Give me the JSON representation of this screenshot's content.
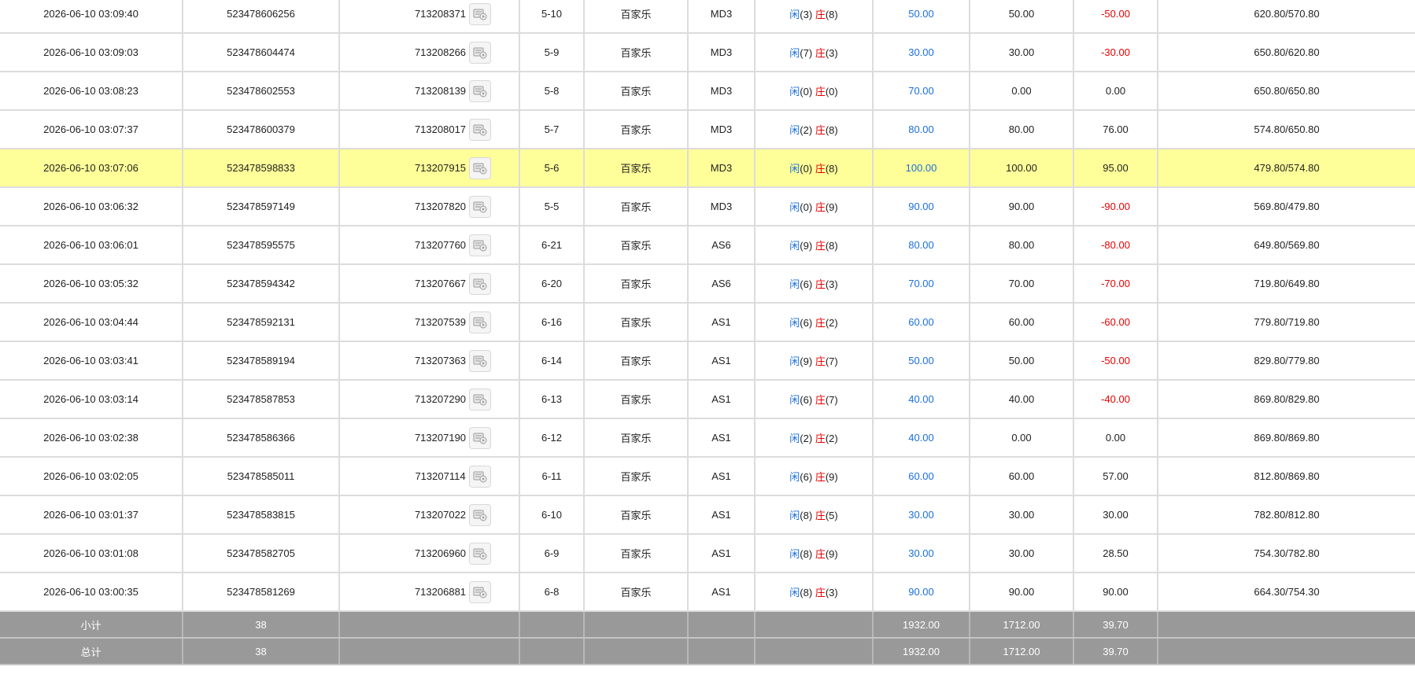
{
  "colors": {
    "highlight_row": "#ffff99",
    "summary_bg": "#999999",
    "blue": "#1a6fd9",
    "red": "#e60000"
  },
  "icon": "video-replay-icon",
  "rows": [
    {
      "time": "2026-06-10 03:09:40",
      "order_no": "523478606256",
      "game_no": "713208371",
      "shoe": "5-10",
      "game": "百家乐",
      "table": "MD3",
      "xian_label": "闲",
      "xian_val": "(3)",
      "zhuang_label": "庄",
      "zhuang_val": "(8)",
      "bet": "50.00",
      "valid": "50.00",
      "win": "-50.00",
      "balance": "620.80/570.80",
      "highlight": false
    },
    {
      "time": "2026-06-10 03:09:03",
      "order_no": "523478604474",
      "game_no": "713208266",
      "shoe": "5-9",
      "game": "百家乐",
      "table": "MD3",
      "xian_label": "闲",
      "xian_val": "(7)",
      "zhuang_label": "庄",
      "zhuang_val": "(3)",
      "bet": "30.00",
      "valid": "30.00",
      "win": "-30.00",
      "balance": "650.80/620.80",
      "highlight": false
    },
    {
      "time": "2026-06-10 03:08:23",
      "order_no": "523478602553",
      "game_no": "713208139",
      "shoe": "5-8",
      "game": "百家乐",
      "table": "MD3",
      "xian_label": "闲",
      "xian_val": "(0)",
      "zhuang_label": "庄",
      "zhuang_val": "(0)",
      "bet": "70.00",
      "valid": "0.00",
      "win": "0.00",
      "balance": "650.80/650.80",
      "highlight": false
    },
    {
      "time": "2026-06-10 03:07:37",
      "order_no": "523478600379",
      "game_no": "713208017",
      "shoe": "5-7",
      "game": "百家乐",
      "table": "MD3",
      "xian_label": "闲",
      "xian_val": "(2)",
      "zhuang_label": "庄",
      "zhuang_val": "(8)",
      "bet": "80.00",
      "valid": "80.00",
      "win": "76.00",
      "balance": "574.80/650.80",
      "highlight": false
    },
    {
      "time": "2026-06-10 03:07:06",
      "order_no": "523478598833",
      "game_no": "713207915",
      "shoe": "5-6",
      "game": "百家乐",
      "table": "MD3",
      "xian_label": "闲",
      "xian_val": "(0)",
      "zhuang_label": "庄",
      "zhuang_val": "(8)",
      "bet": "100.00",
      "valid": "100.00",
      "win": "95.00",
      "balance": "479.80/574.80",
      "highlight": true
    },
    {
      "time": "2026-06-10 03:06:32",
      "order_no": "523478597149",
      "game_no": "713207820",
      "shoe": "5-5",
      "game": "百家乐",
      "table": "MD3",
      "xian_label": "闲",
      "xian_val": "(0)",
      "zhuang_label": "庄",
      "zhuang_val": "(9)",
      "bet": "90.00",
      "valid": "90.00",
      "win": "-90.00",
      "balance": "569.80/479.80",
      "highlight": false
    },
    {
      "time": "2026-06-10 03:06:01",
      "order_no": "523478595575",
      "game_no": "713207760",
      "shoe": "6-21",
      "game": "百家乐",
      "table": "AS6",
      "xian_label": "闲",
      "xian_val": "(9)",
      "zhuang_label": "庄",
      "zhuang_val": "(8)",
      "bet": "80.00",
      "valid": "80.00",
      "win": "-80.00",
      "balance": "649.80/569.80",
      "highlight": false
    },
    {
      "time": "2026-06-10 03:05:32",
      "order_no": "523478594342",
      "game_no": "713207667",
      "shoe": "6-20",
      "game": "百家乐",
      "table": "AS6",
      "xian_label": "闲",
      "xian_val": "(6)",
      "zhuang_label": "庄",
      "zhuang_val": "(3)",
      "bet": "70.00",
      "valid": "70.00",
      "win": "-70.00",
      "balance": "719.80/649.80",
      "highlight": false
    },
    {
      "time": "2026-06-10 03:04:44",
      "order_no": "523478592131",
      "game_no": "713207539",
      "shoe": "6-16",
      "game": "百家乐",
      "table": "AS1",
      "xian_label": "闲",
      "xian_val": "(6)",
      "zhuang_label": "庄",
      "zhuang_val": "(2)",
      "bet": "60.00",
      "valid": "60.00",
      "win": "-60.00",
      "balance": "779.80/719.80",
      "highlight": false
    },
    {
      "time": "2026-06-10 03:03:41",
      "order_no": "523478589194",
      "game_no": "713207363",
      "shoe": "6-14",
      "game": "百家乐",
      "table": "AS1",
      "xian_label": "闲",
      "xian_val": "(9)",
      "zhuang_label": "庄",
      "zhuang_val": "(7)",
      "bet": "50.00",
      "valid": "50.00",
      "win": "-50.00",
      "balance": "829.80/779.80",
      "highlight": false
    },
    {
      "time": "2026-06-10 03:03:14",
      "order_no": "523478587853",
      "game_no": "713207290",
      "shoe": "6-13",
      "game": "百家乐",
      "table": "AS1",
      "xian_label": "闲",
      "xian_val": "(6)",
      "zhuang_label": "庄",
      "zhuang_val": "(7)",
      "bet": "40.00",
      "valid": "40.00",
      "win": "-40.00",
      "balance": "869.80/829.80",
      "highlight": false
    },
    {
      "time": "2026-06-10 03:02:38",
      "order_no": "523478586366",
      "game_no": "713207190",
      "shoe": "6-12",
      "game": "百家乐",
      "table": "AS1",
      "xian_label": "闲",
      "xian_val": "(2)",
      "zhuang_label": "庄",
      "zhuang_val": "(2)",
      "bet": "40.00",
      "valid": "0.00",
      "win": "0.00",
      "balance": "869.80/869.80",
      "highlight": false
    },
    {
      "time": "2026-06-10 03:02:05",
      "order_no": "523478585011",
      "game_no": "713207114",
      "shoe": "6-11",
      "game": "百家乐",
      "table": "AS1",
      "xian_label": "闲",
      "xian_val": "(6)",
      "zhuang_label": "庄",
      "zhuang_val": "(9)",
      "bet": "60.00",
      "valid": "60.00",
      "win": "57.00",
      "balance": "812.80/869.80",
      "highlight": false
    },
    {
      "time": "2026-06-10 03:01:37",
      "order_no": "523478583815",
      "game_no": "713207022",
      "shoe": "6-10",
      "game": "百家乐",
      "table": "AS1",
      "xian_label": "闲",
      "xian_val": "(8)",
      "zhuang_label": "庄",
      "zhuang_val": "(5)",
      "bet": "30.00",
      "valid": "30.00",
      "win": "30.00",
      "balance": "782.80/812.80",
      "highlight": false
    },
    {
      "time": "2026-06-10 03:01:08",
      "order_no": "523478582705",
      "game_no": "713206960",
      "shoe": "6-9",
      "game": "百家乐",
      "table": "AS1",
      "xian_label": "闲",
      "xian_val": "(8)",
      "zhuang_label": "庄",
      "zhuang_val": "(9)",
      "bet": "30.00",
      "valid": "30.00",
      "win": "28.50",
      "balance": "754.30/782.80",
      "highlight": false
    },
    {
      "time": "2026-06-10 03:00:35",
      "order_no": "523478581269",
      "game_no": "713206881",
      "shoe": "6-8",
      "game": "百家乐",
      "table": "AS1",
      "xian_label": "闲",
      "xian_val": "(8)",
      "zhuang_label": "庄",
      "zhuang_val": "(3)",
      "bet": "90.00",
      "valid": "90.00",
      "win": "90.00",
      "balance": "664.30/754.30",
      "highlight": false
    }
  ],
  "summary": [
    {
      "label": "小计",
      "count": "38",
      "bet": "1932.00",
      "valid": "1712.00",
      "win": "39.70"
    },
    {
      "label": "总计",
      "count": "38",
      "bet": "1932.00",
      "valid": "1712.00",
      "win": "39.70"
    }
  ]
}
